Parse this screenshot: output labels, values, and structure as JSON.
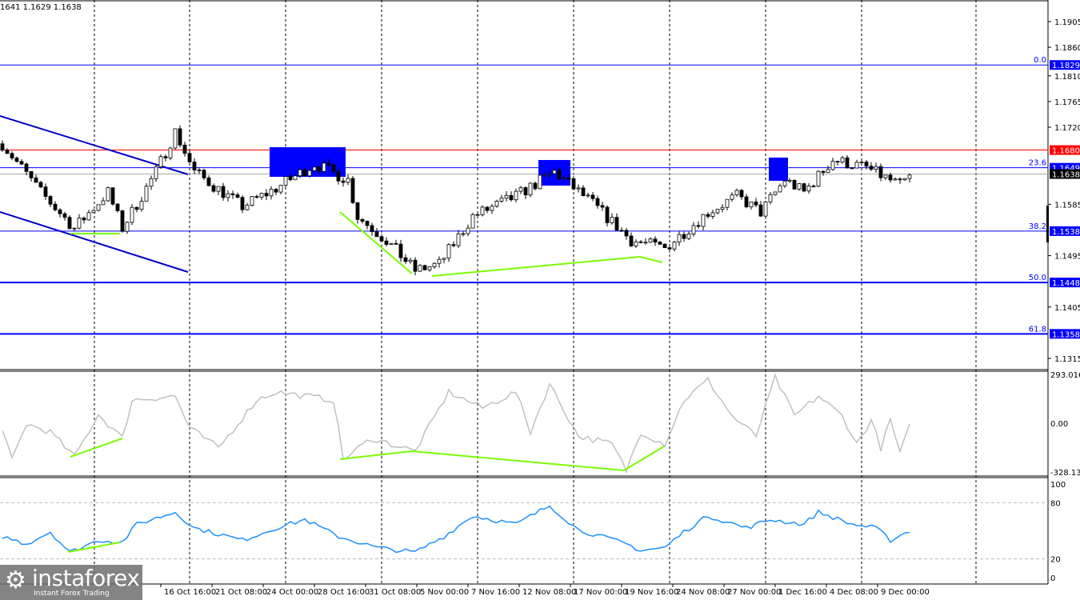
{
  "header": {
    "ohlc": "1641 1.1629 1.1638"
  },
  "logo": {
    "name": "instaforex",
    "tagline": "Instant Forex Trading"
  },
  "chart_data": [
    {
      "type": "candlestick",
      "title": "Price",
      "ylim": [
        1.13,
        1.195
      ],
      "yticks": [
        "1.1905",
        "1.1860",
        "1.1810",
        "1.1765",
        "1.1720",
        "1.1585",
        "1.1495",
        "1.1405",
        "1.1315"
      ],
      "xticks": [
        "16 Oct 16:00",
        "21 Oct 08:00",
        "24 Oct 00:00",
        "28 Oct 16:00",
        "31 Oct 08:00",
        "5 Nov 00:00",
        "7 Nov 16:00",
        "12 Nov 08:00",
        "17 Nov 00:00",
        "19 Nov 16:00",
        "24 Nov 08:00",
        "27 Nov 00:00",
        "1 Dec 16:00",
        "4 Dec 08:00",
        "9 Dec 00:00"
      ],
      "close_path": [
        [
          0,
          1.1691
        ],
        [
          8,
          1.1606
        ],
        [
          15,
          1.1543
        ],
        [
          22,
          1.1606
        ],
        [
          25,
          1.1543
        ],
        [
          32,
          1.1642
        ],
        [
          36,
          1.1712
        ],
        [
          40,
          1.1642
        ],
        [
          50,
          1.1581
        ],
        [
          57,
          1.1613
        ],
        [
          65,
          1.1656
        ],
        [
          72,
          1.1628
        ],
        [
          74,
          1.1564
        ],
        [
          80,
          1.1522
        ],
        [
          86,
          1.1469
        ],
        [
          91,
          1.148
        ],
        [
          98,
          1.1564
        ],
        [
          107,
          1.1599
        ],
        [
          115,
          1.1642
        ],
        [
          123,
          1.1586
        ],
        [
          131,
          1.1522
        ],
        [
          138,
          1.1508
        ],
        [
          147,
          1.1571
        ],
        [
          153,
          1.1599
        ],
        [
          158,
          1.1571
        ],
        [
          163,
          1.1628
        ],
        [
          167,
          1.1606
        ],
        [
          173,
          1.1663
        ],
        [
          180,
          1.1649
        ],
        [
          187,
          1.1618
        ],
        [
          189,
          1.1632
        ]
      ],
      "levels": [
        {
          "price": "1.1829",
          "fib": "0.0",
          "color": "#0000ff"
        },
        {
          "price": "1.1680",
          "fib": "",
          "color": "#ff0000"
        },
        {
          "price": "1.1649",
          "fib": "23.6",
          "color": "#0000ff"
        },
        {
          "price": "1.1638",
          "fib": "",
          "color": "#000000"
        },
        {
          "price": "1.1538",
          "fib": "38.2",
          "color": "#0000ff"
        },
        {
          "price": "1.1448",
          "fib": "50.0",
          "color": "#0000ff"
        },
        {
          "price": "1.1358",
          "fib": "61.8",
          "color": "#0000ff"
        }
      ]
    },
    {
      "type": "line",
      "title": "CCI",
      "ylim": [
        -328.1318,
        293.0166
      ],
      "yticks": [
        "293.0166",
        "0.00",
        "-328.1318"
      ],
      "color": "#c0c0c0",
      "path": [
        [
          0,
          -64
        ],
        [
          2,
          -236
        ],
        [
          5,
          -15
        ],
        [
          10,
          -64
        ],
        [
          15,
          -216
        ],
        [
          20,
          44
        ],
        [
          25,
          -103
        ],
        [
          27,
          133
        ],
        [
          36,
          157
        ],
        [
          39,
          -39
        ],
        [
          45,
          -162
        ],
        [
          53,
          133
        ],
        [
          57,
          182
        ],
        [
          63,
          157
        ],
        [
          69,
          133
        ],
        [
          71,
          -231
        ],
        [
          77,
          -103
        ],
        [
          86,
          -182
        ],
        [
          93,
          182
        ],
        [
          100,
          84
        ],
        [
          107,
          182
        ],
        [
          110,
          -64
        ],
        [
          114,
          231
        ],
        [
          120,
          -89
        ],
        [
          127,
          -138
        ],
        [
          130,
          -300
        ],
        [
          133,
          -64
        ],
        [
          138,
          -138
        ],
        [
          142,
          133
        ],
        [
          147,
          256
        ],
        [
          152,
          34
        ],
        [
          157,
          -89
        ],
        [
          161,
          271
        ],
        [
          165,
          34
        ],
        [
          170,
          157
        ],
        [
          175,
          34
        ],
        [
          178,
          -138
        ],
        [
          181,
          10
        ],
        [
          183,
          -162
        ],
        [
          185,
          10
        ],
        [
          187,
          -197
        ],
        [
          189,
          -30
        ]
      ]
    },
    {
      "type": "line",
      "title": "Stochastic/RSI",
      "ylim": [
        0,
        100
      ],
      "yticks": [
        "100",
        "80",
        "20",
        "0"
      ],
      "color": "#1e90ff",
      "path": [
        [
          0,
          44
        ],
        [
          5,
          36
        ],
        [
          10,
          49
        ],
        [
          14,
          27
        ],
        [
          20,
          40
        ],
        [
          25,
          38
        ],
        [
          28,
          57
        ],
        [
          36,
          70
        ],
        [
          40,
          53
        ],
        [
          50,
          40
        ],
        [
          57,
          53
        ],
        [
          63,
          62
        ],
        [
          70,
          44
        ],
        [
          78,
          32
        ],
        [
          86,
          27
        ],
        [
          92,
          44
        ],
        [
          98,
          66
        ],
        [
          107,
          57
        ],
        [
          114,
          77
        ],
        [
          120,
          51
        ],
        [
          130,
          36
        ],
        [
          133,
          29
        ],
        [
          138,
          32
        ],
        [
          142,
          49
        ],
        [
          147,
          66
        ],
        [
          155,
          53
        ],
        [
          160,
          62
        ],
        [
          167,
          57
        ],
        [
          170,
          70
        ],
        [
          177,
          57
        ],
        [
          182,
          53
        ],
        [
          185,
          40
        ],
        [
          189,
          50
        ]
      ]
    }
  ]
}
